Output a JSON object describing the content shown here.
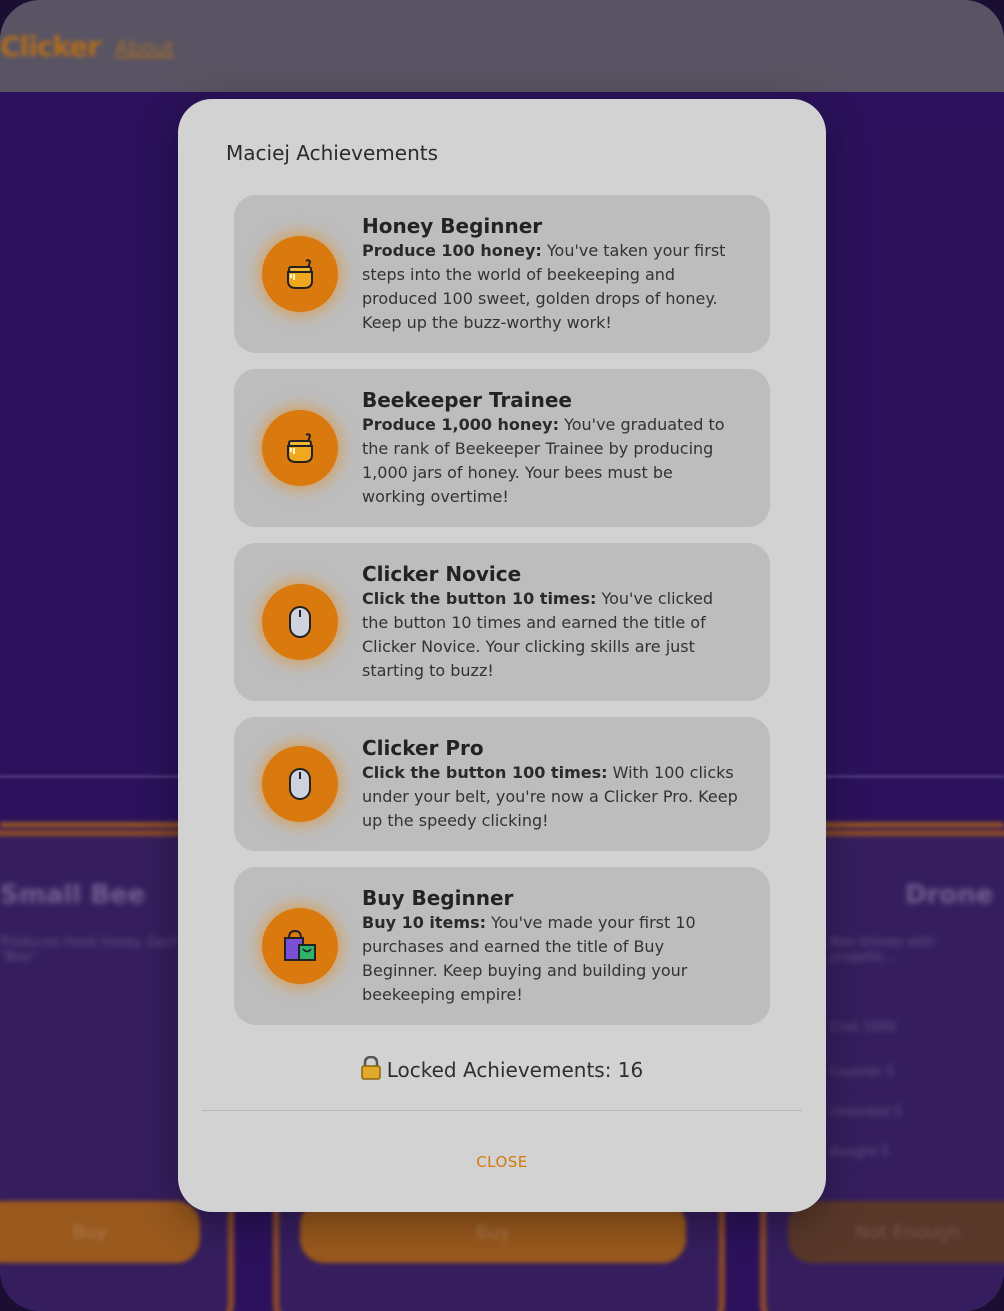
{
  "background": {
    "brand": "Clicker",
    "nav_about": "About",
    "left_card_title": "Small Bee",
    "left_card_desc": "Produces more honey. Each \"Bee\"",
    "left_card_button": "Buy",
    "center_card_button": "Buy",
    "right_card_title": "Drone",
    "right_card_desc": "Bee drones with propelle...",
    "right_card_button": "Not Enough",
    "right_card_stats": [
      "Cost 1000",
      "Counter 5",
      "Unlocked 5",
      "Bought 5"
    ]
  },
  "modal": {
    "title": "Maciej Achievements",
    "achievements": [
      {
        "icon": "honey-pot-icon",
        "name": "Honey Beginner",
        "requirement": "Produce 100 honey:",
        "description": "You've taken your first steps into the world of beekeeping and produced 100 sweet, golden drops of honey. Keep up the buzz-worthy work!"
      },
      {
        "icon": "honey-pot-icon",
        "name": "Beekeeper Trainee",
        "requirement": "Produce 1,000 honey:",
        "description": "You've graduated to the rank of Beekeeper Trainee by producing 1,000 jars of honey. Your bees must be working overtime!"
      },
      {
        "icon": "mouse-icon",
        "name": "Clicker Novice",
        "requirement": "Click the button 10 times:",
        "description": "You've clicked the button 10 times and earned the title of Clicker Novice. Your clicking skills are just starting to buzz!"
      },
      {
        "icon": "mouse-icon",
        "name": "Clicker Pro",
        "requirement": "Click the button 100 times:",
        "description": "With 100 clicks under your belt, you're now a Clicker Pro. Keep up the speedy clicking!"
      },
      {
        "icon": "shopping-bags-icon",
        "name": "Buy Beginner",
        "requirement": "Buy 10 items:",
        "description": "You've made your first 10 purchases and earned the title of Buy Beginner. Keep buying and building your beekeeping empire!"
      }
    ],
    "locked_label": "Locked Achievements: 16",
    "close_label": "CLOSE"
  },
  "colors": {
    "accent": "#d9790e",
    "modal_bg": "#d2d2d2",
    "card_bg": "#bdbdbd",
    "page_bg": "#2e1263"
  }
}
